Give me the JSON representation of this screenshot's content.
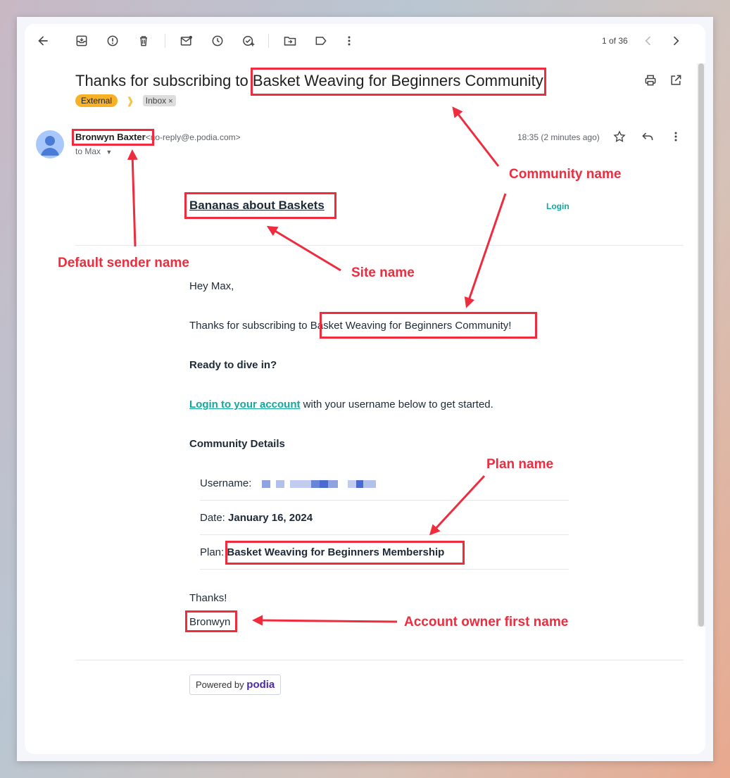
{
  "toolbar": {
    "pager": "1 of 36"
  },
  "email": {
    "subject_prefix": "Thanks for subscribing to ",
    "subject_community": "Basket Weaving for Beginners Community",
    "subject_suffix": "!",
    "tag_external": "External",
    "tag_inbox": "Inbox",
    "tag_inbox_close": "×",
    "sender_name": "Bronwyn Baxter",
    "sender_email": "<no-reply@e.podia.com>",
    "to_line": "to Max",
    "time": "18:35 (2 minutes ago)"
  },
  "body": {
    "site_name": "Bananas about Baskets",
    "login_top": "Login",
    "greeting": "Hey Max,",
    "thanks_prefix": "Thanks for subscribing to ",
    "thanks_community": "Basket Weaving for Beginners Community",
    "thanks_suffix": "!",
    "ready": "Ready to dive in?",
    "login_link": "Login to your account",
    "login_rest": " with your username below to get started.",
    "details_heading": "Community Details",
    "username_label": "Username:",
    "date_label": "Date:",
    "date_value": "January 16, 2024",
    "plan_label": "Plan:",
    "plan_value": "Basket Weaving for Beginners Membership",
    "signoff": "Thanks!",
    "signature": "Bronwyn",
    "powered_by": "Powered by",
    "powered_brand": "podia"
  },
  "annotations": {
    "community_name": "Community name",
    "default_sender": "Default sender name",
    "site_name": "Site name",
    "plan_name": "Plan name",
    "owner_first_name": "Account owner first name"
  },
  "colors": {
    "annotation": "#ef2b3e",
    "link": "#13a89e",
    "external_tag": "#f7b125",
    "podia_brand": "#4b2aa8"
  }
}
